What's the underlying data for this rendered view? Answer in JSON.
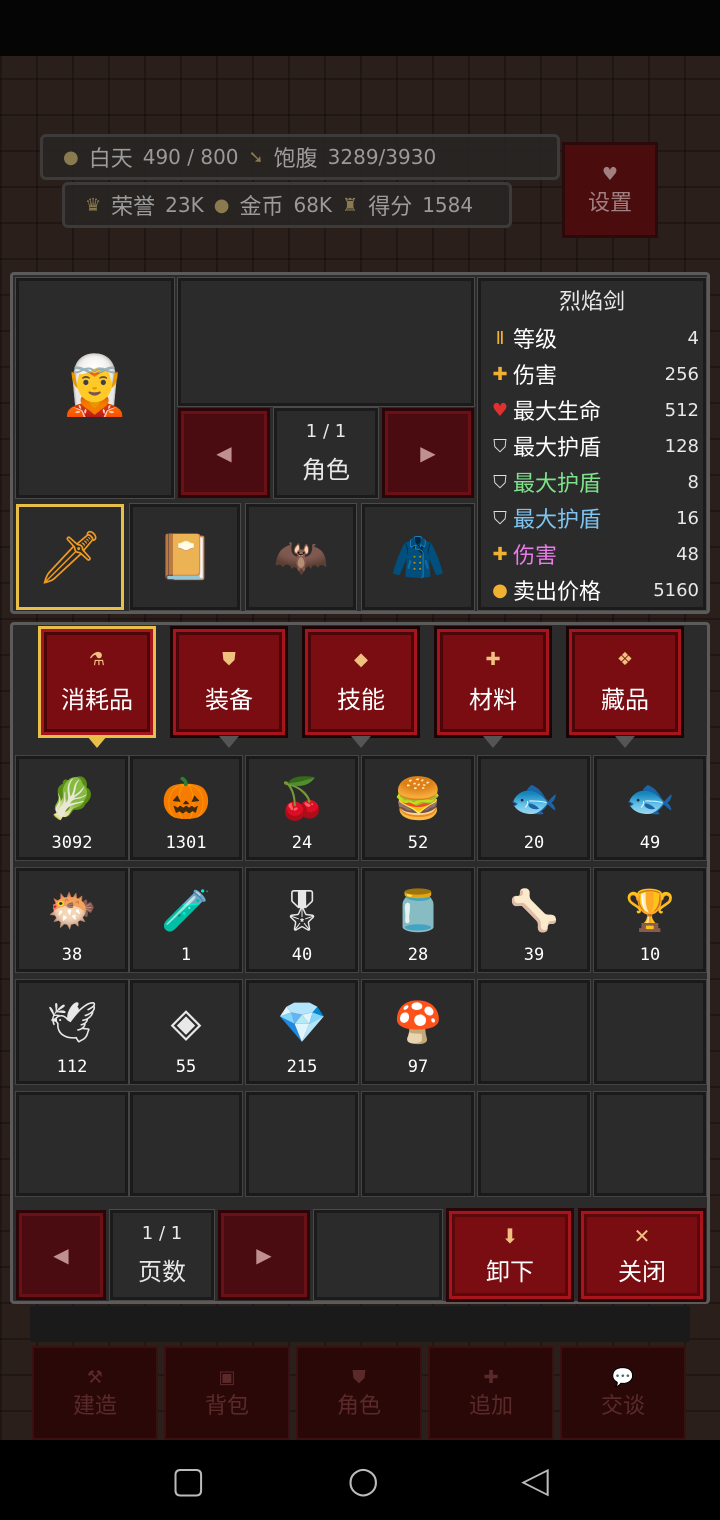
{
  "hud": {
    "day_label": "白天",
    "day_value": "490 / 800",
    "hunger_label": "饱腹",
    "hunger_value": "3289/3930",
    "honor_label": "荣誉",
    "honor_value": "23K",
    "gold_label": "金币",
    "gold_value": "68K",
    "score_label": "得分",
    "score_value": "1584",
    "settings_label": "设置"
  },
  "character": {
    "page": "1  /  1",
    "page_label": "角色"
  },
  "item_stats": {
    "name": "烈焰剑",
    "rows": [
      {
        "label": "等级",
        "value": "4",
        "color": "#ffffff"
      },
      {
        "label": "伤害",
        "value": "256",
        "color": "#ffffff"
      },
      {
        "label": "最大生命",
        "value": "512",
        "color": "#ffffff"
      },
      {
        "label": "最大护盾",
        "value": "128",
        "color": "#ffffff"
      },
      {
        "label": "最大护盾",
        "value": "8",
        "color": "#7fe28a"
      },
      {
        "label": "最大护盾",
        "value": "16",
        "color": "#7ec4f0"
      },
      {
        "label": "伤害",
        "value": "48",
        "color": "#e87ce8"
      },
      {
        "label": "卖出价格",
        "value": "5160",
        "color": "#ffffff"
      }
    ]
  },
  "tabs": [
    "消耗品",
    "装备",
    "技能",
    "材料",
    "藏品"
  ],
  "inventory": [
    {
      "icon": "turnip-icon",
      "glyph": "🥬",
      "count": "3092"
    },
    {
      "icon": "pumpkin-icon",
      "glyph": "🎃",
      "count": "1301"
    },
    {
      "icon": "cherries-icon",
      "glyph": "🍒",
      "count": "24"
    },
    {
      "icon": "burger-icon",
      "glyph": "🍔",
      "count": "52"
    },
    {
      "icon": "green-fish-icon",
      "glyph": "🐟",
      "count": "20"
    },
    {
      "icon": "tan-fish-icon",
      "glyph": "🐟",
      "count": "49"
    },
    {
      "icon": "blue-fish-icon",
      "glyph": "🐡",
      "count": "38"
    },
    {
      "icon": "potion-icon",
      "glyph": "🧪",
      "count": "1"
    },
    {
      "icon": "medal-icon",
      "glyph": "🎖",
      "count": "40"
    },
    {
      "icon": "jar-icon",
      "glyph": "🫙",
      "count": "28"
    },
    {
      "icon": "bone-icon",
      "glyph": "🦴",
      "count": "39"
    },
    {
      "icon": "goblet-icon",
      "glyph": "🏆",
      "count": "10"
    },
    {
      "icon": "angel-trophy-icon",
      "glyph": "🕊",
      "count": "112"
    },
    {
      "icon": "gold-emblem-icon",
      "glyph": "◈",
      "count": "55"
    },
    {
      "icon": "crystal-icon",
      "glyph": "💎",
      "count": "215"
    },
    {
      "icon": "horn-trophy-icon",
      "glyph": "🍄",
      "count": "97"
    }
  ],
  "pager": {
    "page": "1  /  1",
    "page_label": "页数"
  },
  "actions": {
    "unequip": "卸下",
    "close": "关闭"
  },
  "bottom_menu": [
    "建造",
    "背包",
    "角色",
    "追加",
    "交谈"
  ]
}
